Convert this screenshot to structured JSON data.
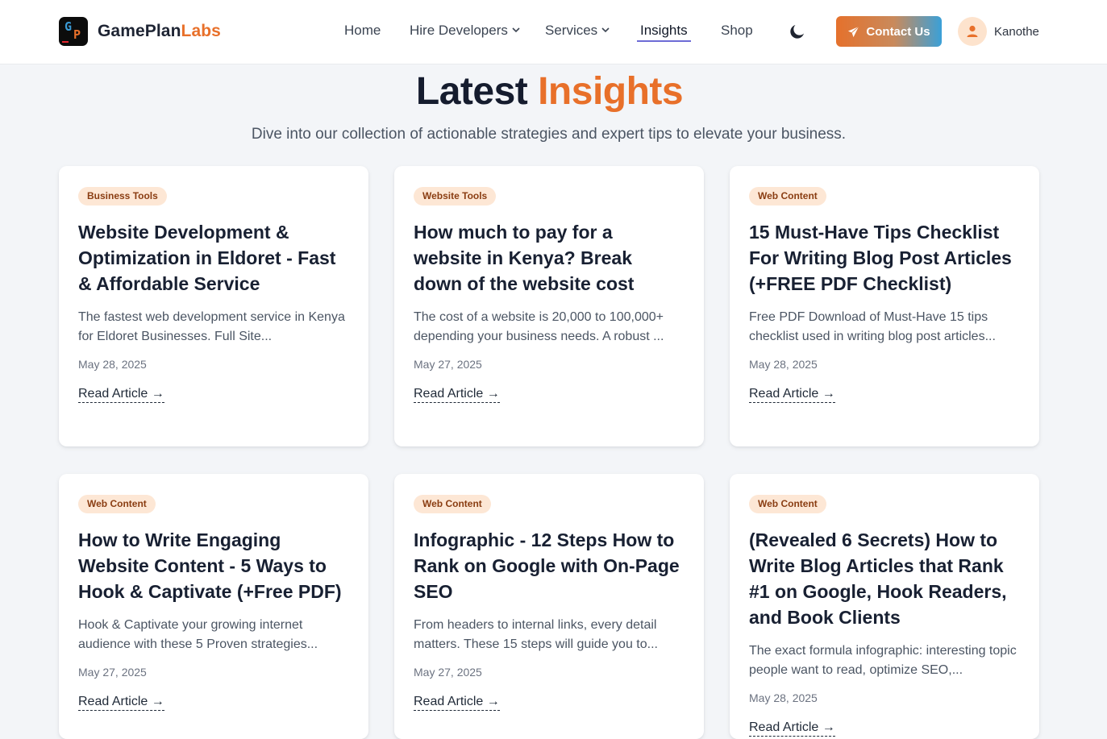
{
  "header": {
    "logo_text": "GamePlan",
    "logo_accent": "Labs",
    "nav": [
      {
        "label": "Home",
        "dropdown": false,
        "active": false
      },
      {
        "label": "Hire Developers",
        "dropdown": true,
        "active": false
      },
      {
        "label": "Services",
        "dropdown": true,
        "active": false
      },
      {
        "label": "Insights",
        "dropdown": false,
        "active": true
      },
      {
        "label": "Shop",
        "dropdown": false,
        "active": false
      }
    ],
    "theme_icon": "moon-icon",
    "contact_label": "Contact Us",
    "contact_icon": "paper-plane-icon",
    "user_name": "Kanothe",
    "user_icon": "user-icon"
  },
  "hero": {
    "title_main": "Latest",
    "title_accent": "Insights",
    "subtitle": "Dive into our collection of actionable strategies and expert tips to elevate your business."
  },
  "cards": [
    {
      "tag": "Business Tools",
      "title": "Website Development & Optimization in Eldoret - Fast & Affordable Service",
      "excerpt": "The fastest web development service in Kenya for Eldoret Businesses. Full Site...",
      "date": "May 28, 2025",
      "link": "Read Article →"
    },
    {
      "tag": "Website Tools",
      "title": "How much to pay for a website in Kenya? Break down of the website cost",
      "excerpt": "The cost of a website is 20,000 to 100,000+ depending your business needs. A robust ...",
      "date": "May 27, 2025",
      "link": "Read Article →"
    },
    {
      "tag": "Web Content",
      "title": "15 Must-Have Tips Checklist For Writing Blog Post Articles (+FREE PDF Checklist)",
      "excerpt": "Free PDF Download of Must-Have 15 tips checklist used in writing blog post articles...",
      "date": "May 28, 2025",
      "link": "Read Article →"
    },
    {
      "tag": "Web Content",
      "title": "How to Write Engaging Website Content - 5 Ways to Hook & Captivate (+Free PDF)",
      "excerpt": "Hook & Captivate your growing internet audience with these 5 Proven strategies...",
      "date": "May 27, 2025",
      "link": "Read Article →"
    },
    {
      "tag": "Web Content",
      "title": "Infographic - 12 Steps How to Rank on Google with On-Page SEO",
      "excerpt": "From headers to internal links, every detail matters. These 15 steps will guide you to...",
      "date": "May 27, 2025",
      "link": "Read Article →"
    },
    {
      "tag": "Web Content",
      "title": "(Revealed 6 Secrets) How to Write Blog Articles that Rank #1 on Google, Hook Readers, and Book Clients",
      "excerpt": "The exact formula infographic: interesting topic people want to read, optimize SEO,...",
      "date": "May 28, 2025",
      "link": "Read Article →"
    }
  ],
  "colors": {
    "accent_orange": "#e8702a",
    "accent_blue": "#3aa0d8",
    "tag_bg": "#fde7d5",
    "tag_text": "#8a3d12",
    "page_bg": "#f3f5f8"
  }
}
